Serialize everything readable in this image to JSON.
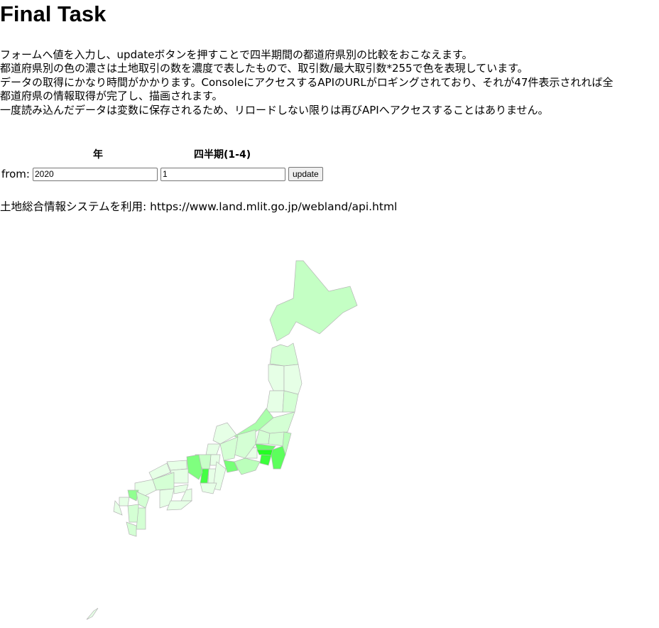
{
  "title": "Final Task",
  "description": [
    "フォームへ値を入力し、updateボタンを押すことで四半期間の都道府県別の比較をおこなえます。",
    "都道府県別の色の濃さは土地取引の数を濃度で表したもので、取引数/最大取引数*255で色を表現しています。",
    "データの取得にかなり時間がかかります。ConsoleにアクセスするAPIのURLがロギングされており、それが47件表示されれば全",
    "都道府県の情報取得が完了し、描画されます。",
    "一度読み込んだデータは変数に保存されるため、リロードしない限りは再びAPIへアクセスすることはありません。"
  ],
  "form": {
    "year_header": "年",
    "quarter_header": "四半期(1-4)",
    "from_label": "from:",
    "year_value": "2020",
    "quarter_value": "1",
    "update_label": "update"
  },
  "source": "土地総合情報システムを利用: https://www.land.mlit.go.jp/webland/api.html",
  "map_colors": {
    "hokkaido": "#c4ffc4",
    "tokyo": "#22ff22",
    "kanagawa": "#3cff3c",
    "chiba": "#5cff5c",
    "saitama": "#66ff66",
    "aichi": "#77ff77",
    "osaka": "#44ff44",
    "hyogo": "#7fff7f",
    "fukuoka": "#90ff90",
    "kyoto": "#c8ffc8",
    "shizuoka": "#bbffbb",
    "niigata": "#aaffaa",
    "ibaraki": "#bbffbb",
    "mid": "#d4ffd4",
    "light": "#e6ffe6"
  }
}
